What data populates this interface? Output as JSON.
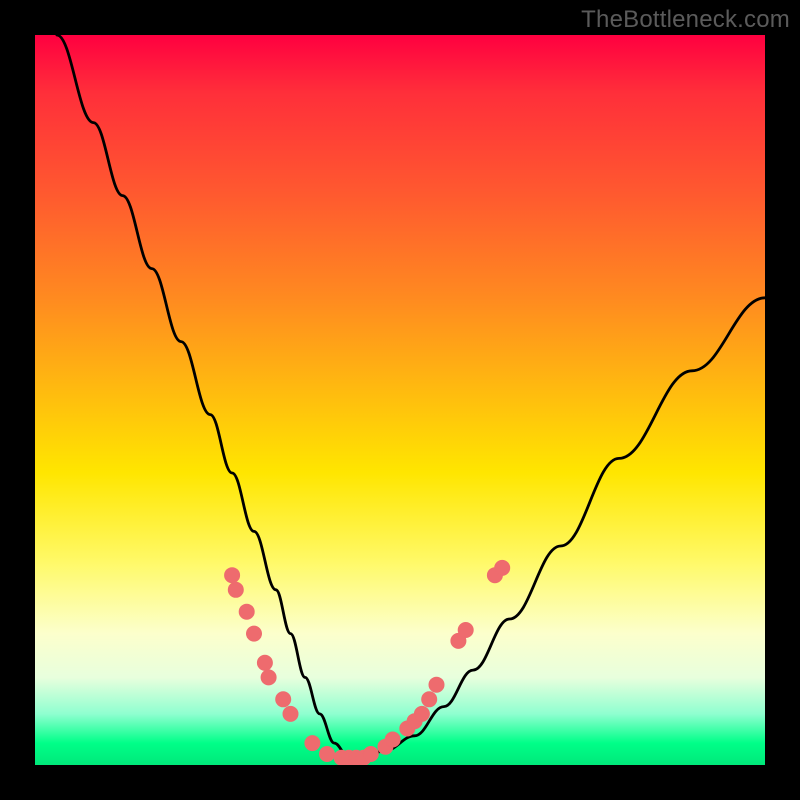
{
  "watermark": "TheBottleneck.com",
  "chart_data": {
    "type": "line",
    "title": "",
    "xlabel": "",
    "ylabel": "",
    "xlim": [
      0,
      100
    ],
    "ylim": [
      0,
      100
    ],
    "grid": false,
    "legend": false,
    "background_gradient": {
      "direction": "vertical",
      "stops": [
        {
          "pos": 0,
          "color": "#ff0040",
          "meaning": "high-bottleneck"
        },
        {
          "pos": 50,
          "color": "#ffe600",
          "meaning": "moderate"
        },
        {
          "pos": 100,
          "color": "#00e87a",
          "meaning": "no-bottleneck"
        }
      ]
    },
    "series": [
      {
        "name": "bottleneck-curve",
        "x": [
          3,
          8,
          12,
          16,
          20,
          24,
          27,
          30,
          33,
          35,
          37,
          39,
          41,
          43,
          45,
          48,
          52,
          56,
          60,
          65,
          72,
          80,
          90,
          100
        ],
        "y": [
          100,
          88,
          78,
          68,
          58,
          48,
          40,
          32,
          24,
          18,
          12,
          7,
          3,
          1,
          1,
          2,
          4,
          8,
          13,
          20,
          30,
          42,
          54,
          64
        ]
      }
    ],
    "markers": {
      "name": "highlighted-points",
      "color": "#ee6b6e",
      "radius_rel": 1.0,
      "points": [
        {
          "x": 27,
          "y": 26
        },
        {
          "x": 27.5,
          "y": 24
        },
        {
          "x": 29,
          "y": 21
        },
        {
          "x": 30,
          "y": 18
        },
        {
          "x": 31.5,
          "y": 14
        },
        {
          "x": 32,
          "y": 12
        },
        {
          "x": 34,
          "y": 9
        },
        {
          "x": 35,
          "y": 7
        },
        {
          "x": 38,
          "y": 3
        },
        {
          "x": 40,
          "y": 1.5
        },
        {
          "x": 42,
          "y": 1
        },
        {
          "x": 43,
          "y": 1
        },
        {
          "x": 44,
          "y": 1
        },
        {
          "x": 45,
          "y": 1
        },
        {
          "x": 46,
          "y": 1.5
        },
        {
          "x": 48,
          "y": 2.5
        },
        {
          "x": 49,
          "y": 3.5
        },
        {
          "x": 51,
          "y": 5
        },
        {
          "x": 52,
          "y": 6
        },
        {
          "x": 53,
          "y": 7
        },
        {
          "x": 54,
          "y": 9
        },
        {
          "x": 55,
          "y": 11
        },
        {
          "x": 58,
          "y": 17
        },
        {
          "x": 59,
          "y": 18.5
        },
        {
          "x": 63,
          "y": 26
        },
        {
          "x": 64,
          "y": 27
        }
      ]
    }
  }
}
